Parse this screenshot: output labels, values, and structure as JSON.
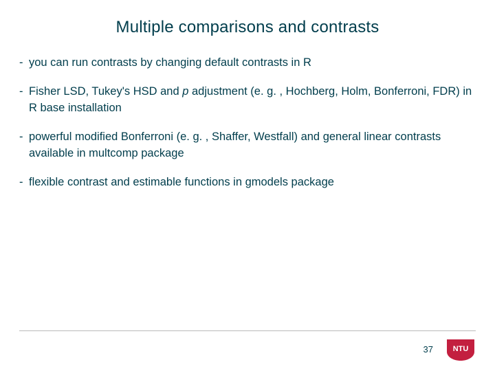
{
  "slide": {
    "title": "Multiple comparisons and contrasts",
    "bullets": [
      {
        "html": "you can run contrasts by changing default contrasts in R"
      },
      {
        "html": "Fisher LSD, Tukey's HSD and <em>p</em> adjustment (e. g. , Hochberg, Holm, Bonferroni, FDR) in R base installation"
      },
      {
        "html": "powerful modified Bonferroni (e. g. , Shaffer, Westfall) and general linear contrasts available in multcomp package"
      },
      {
        "html": "flexible contrast and estimable functions in gmodels package"
      }
    ],
    "page_number": "37",
    "logo_text": "NTU",
    "logo_color": "#c31f3f"
  }
}
